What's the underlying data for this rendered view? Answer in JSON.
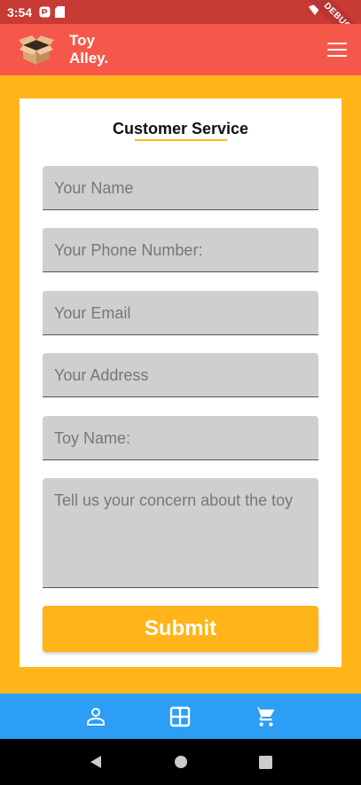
{
  "status_bar": {
    "time": "3:54",
    "debug_label": "DEBUG"
  },
  "app_bar": {
    "brand_line1": "Toy",
    "brand_line2": "Alley."
  },
  "form": {
    "title": "Customer Service",
    "fields": {
      "name_placeholder": "Your Name",
      "phone_placeholder": "Your Phone Number:",
      "email_placeholder": "Your Email",
      "address_placeholder": "Your Address",
      "toy_placeholder": "Toy Name:",
      "concern_placeholder": "Tell us your concern about the toy"
    },
    "submit_label": "Submit"
  },
  "bottom_nav": {
    "items": [
      "person-icon",
      "grid-icon",
      "cart-icon"
    ]
  },
  "colors": {
    "primary": "#f5574a",
    "accent": "#ffb41a",
    "nav": "#2c9ef5"
  }
}
